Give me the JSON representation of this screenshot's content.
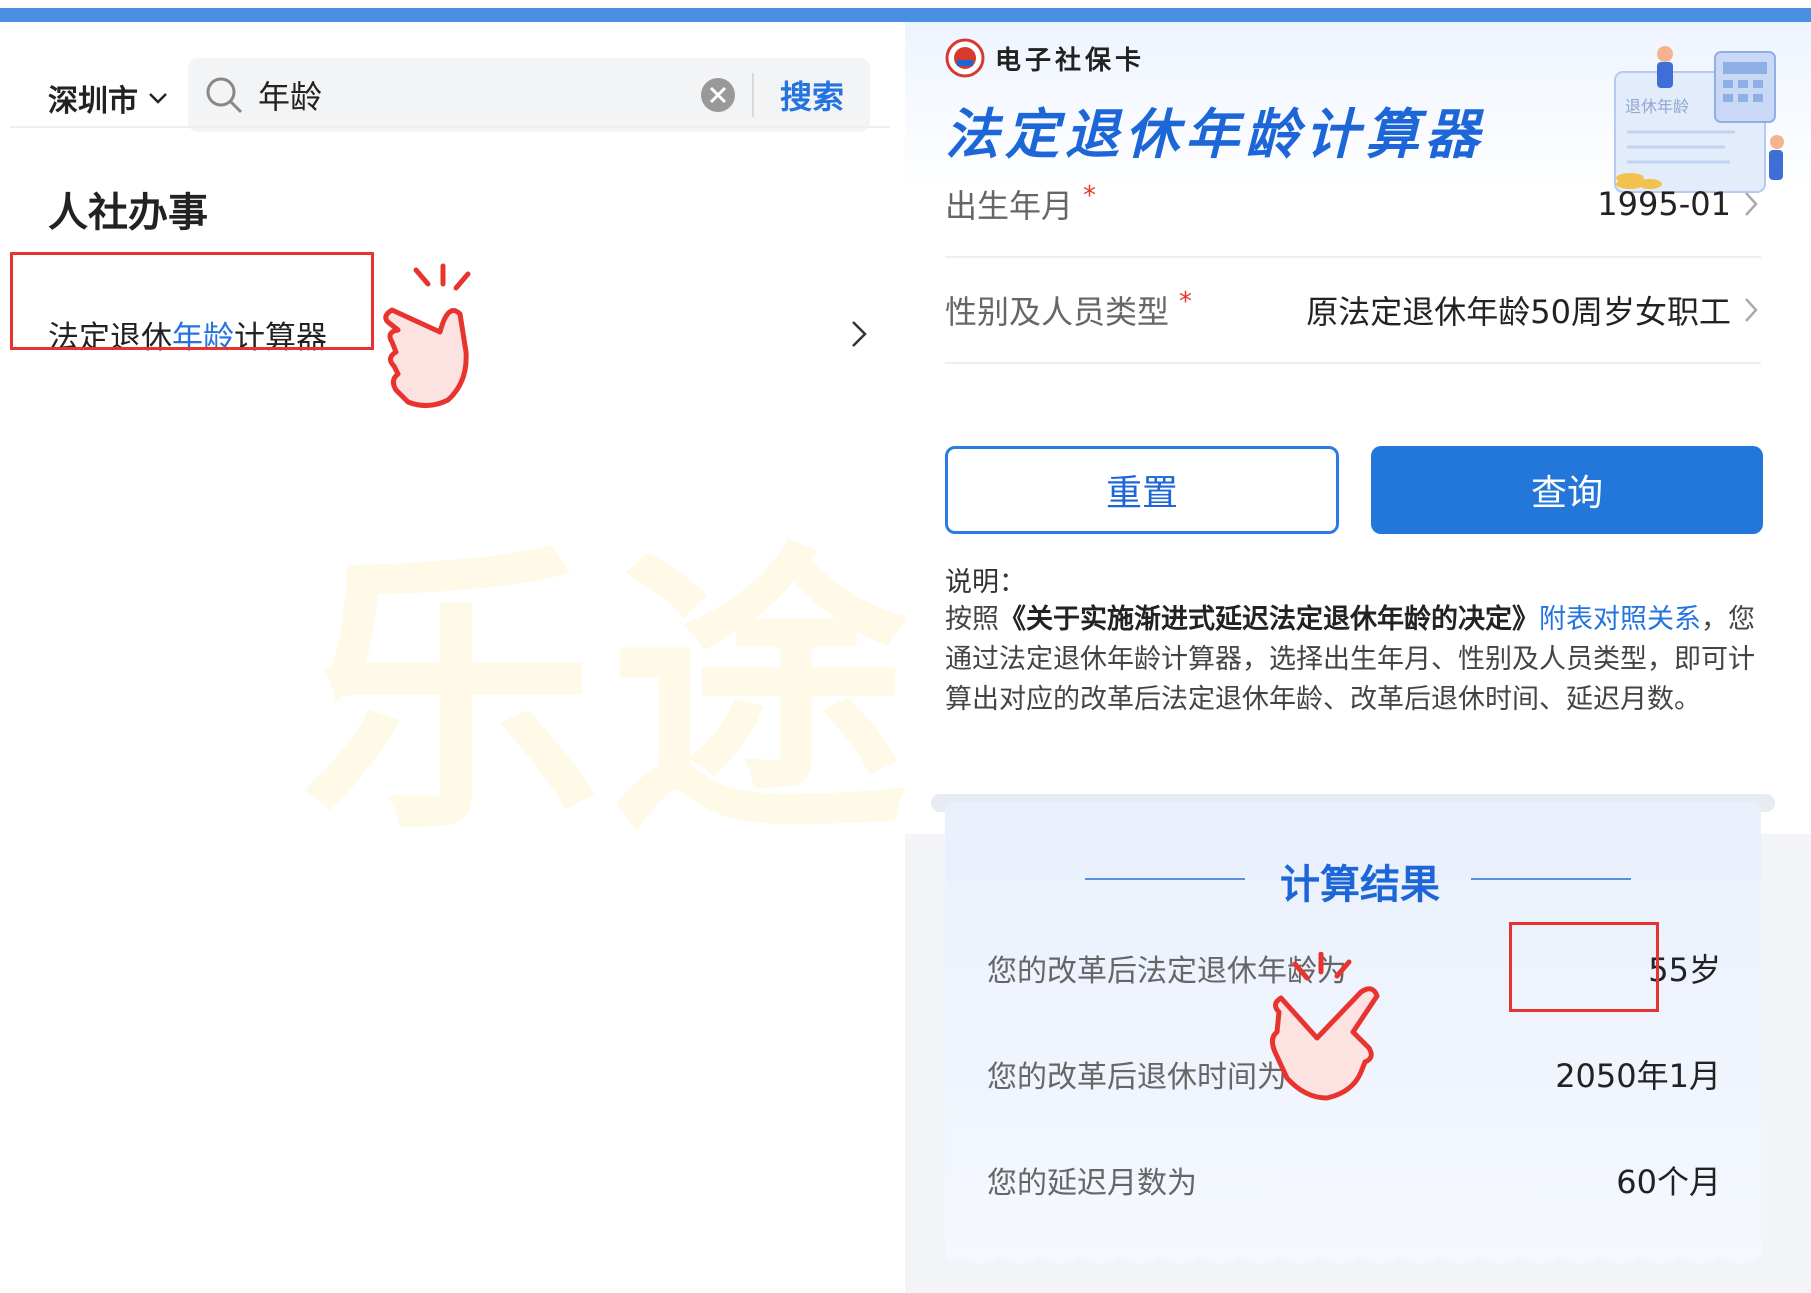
{
  "left": {
    "city": "深圳市",
    "search_value": "年龄",
    "search_button": "搜索",
    "section_title": "人社办事",
    "result_pre": "法定退休",
    "result_hl": "年龄",
    "result_post": "计算器"
  },
  "right": {
    "brand": "电子社保卡",
    "title": "法定退休年龄计算器",
    "illustration_text": "退休年龄",
    "birth_label": "出生年月",
    "birth_value": "1995-01",
    "type_label": "性别及人员类型",
    "type_value": "原法定退休年龄50周岁女职工",
    "required_mark": "*",
    "reset_button": "重置",
    "query_button": "查询",
    "note_label": "说明：",
    "note_pre": "按照",
    "note_bold": "《关于实施渐进式延迟法定退休年龄的决定》",
    "note_link": "附表对照关系",
    "note_post": "，您通过法定退休年龄计算器，选择出生年月、性别及人员类型，即可计算出对应的改革后法定退休年龄、改革后退休时间、延迟月数。",
    "result_title": "计算结果",
    "results": [
      {
        "label": "您的改革后法定退休年龄为",
        "value": "55岁"
      },
      {
        "label": "您的改革后退休时间为",
        "value": "2050年1月"
      },
      {
        "label": "您的延迟月数为",
        "value": "60个月"
      }
    ]
  },
  "watermark": "乐途养老",
  "colors": {
    "accent": "#2374e1",
    "highlight_box": "#e8342f",
    "top_bar": "#4a90e2"
  }
}
